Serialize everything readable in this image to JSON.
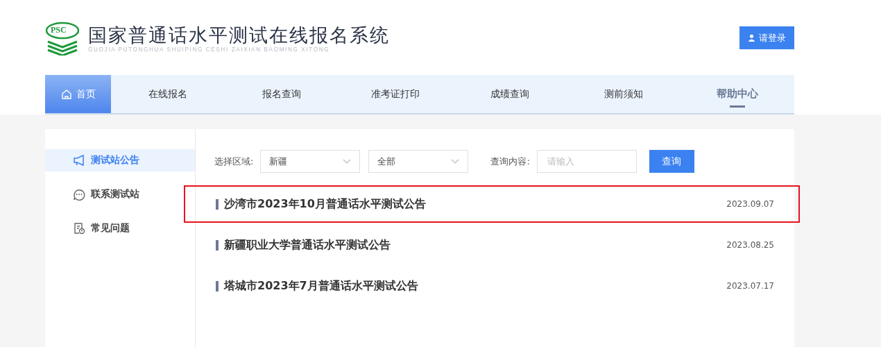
{
  "header": {
    "logo_badge": "PSC",
    "title": "国家普通话水平测试在线报名系统",
    "subtitle": "GUOJIA PUTONGHUA SHUIPING CESHI ZAIXIAN BAOMING XITONG",
    "login_button": "请登录"
  },
  "nav": [
    {
      "label": "首页",
      "selected": true,
      "emphasized": false,
      "kind": "home"
    },
    {
      "label": "在线报名",
      "selected": false,
      "emphasized": false,
      "kind": "text"
    },
    {
      "label": "报名查询",
      "selected": false,
      "emphasized": false,
      "kind": "text"
    },
    {
      "label": "准考证打印",
      "selected": false,
      "emphasized": false,
      "kind": "text"
    },
    {
      "label": "成绩查询",
      "selected": false,
      "emphasized": false,
      "kind": "text"
    },
    {
      "label": "测前须知",
      "selected": false,
      "emphasized": false,
      "kind": "text"
    },
    {
      "label": "帮助中心",
      "selected": false,
      "emphasized": true,
      "kind": "text"
    }
  ],
  "sidebar": {
    "items": [
      {
        "label": "测试站公告",
        "selected": true,
        "kind": "megaphone"
      },
      {
        "label": "联系测试站",
        "selected": false,
        "kind": "chat"
      },
      {
        "label": "常见问题",
        "selected": false,
        "kind": "document"
      }
    ]
  },
  "filters": {
    "region_label": "选择区域:",
    "region_value": "新疆",
    "scope_value": "全部",
    "query_label": "查询内容:",
    "query_placeholder": "请输入",
    "search_button": "查询"
  },
  "notices": [
    {
      "title": "沙湾市2023年10月普通话水平测试公告",
      "date": "2023.09.07",
      "highlighted": true
    },
    {
      "title": "新疆职业大学普通话水平测试公告",
      "date": "2023.08.25",
      "highlighted": false
    },
    {
      "title": "塔城市2023年7月普通话水平测试公告",
      "date": "2023.07.17",
      "highlighted": false
    }
  ]
}
